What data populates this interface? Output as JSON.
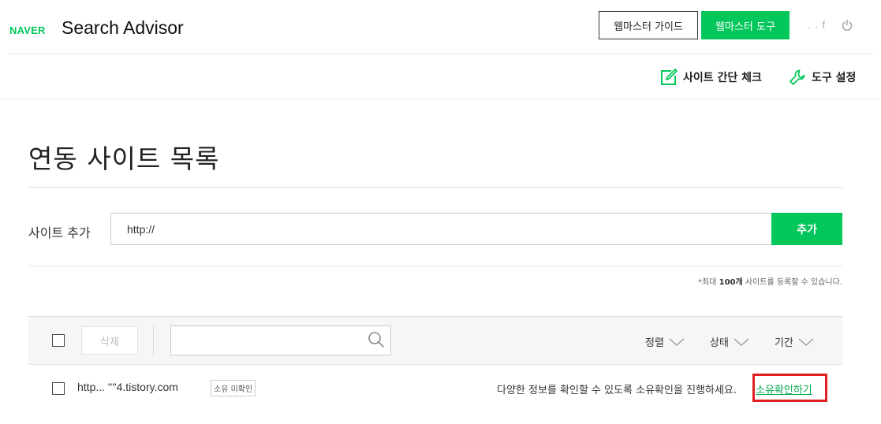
{
  "header": {
    "logo": "NAVER",
    "product": "Search Advisor",
    "guide_button": "웹마스터 가이드",
    "tools_button": "웹마스터 도구",
    "user_name": ". . f"
  },
  "subnav": {
    "check_label": "사이트 간단 체크",
    "tools_label": "도구 설정"
  },
  "page": {
    "title": "연동 사이트 목록"
  },
  "add_site": {
    "label": "사이트 추가",
    "input_value": "http://",
    "button": "추가",
    "limit_prefix": "*최대 ",
    "limit_count": "100개",
    "limit_suffix": " 사이트를 등록할 수 있습니다."
  },
  "toolbar": {
    "delete_button": "삭제",
    "search_value": "",
    "sort_label": "정렬",
    "status_label": "상태",
    "period_label": "기간"
  },
  "sites": [
    {
      "url": "http...  ''''4.tistory.com",
      "badge": "소유 미확인",
      "message": "다양한 정보를 확인할 수 있도록 소유확인을 진행하세요.",
      "action": "소유확인하기"
    }
  ],
  "colors": {
    "brand_green": "#03c75a",
    "highlight_red": "#e02020"
  }
}
